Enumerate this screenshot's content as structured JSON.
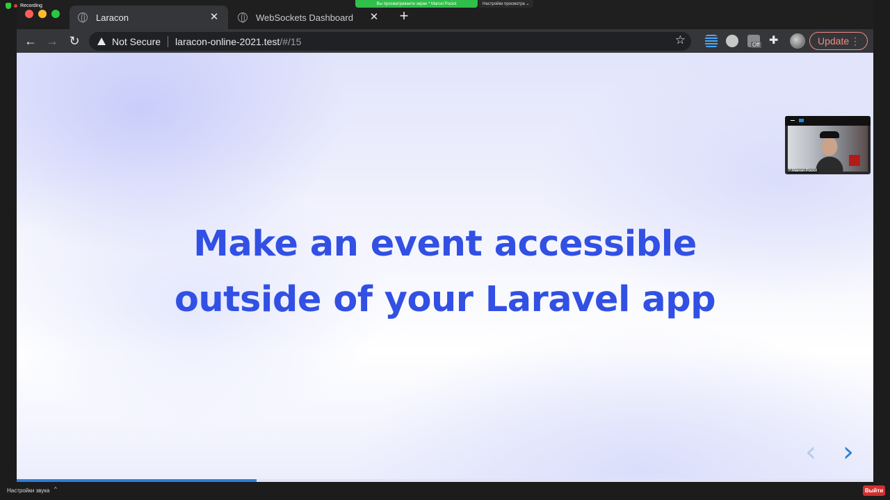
{
  "zoom": {
    "recording_label": "Recording",
    "share_banner": "Вы просматриваете экран * Marcel Pociot",
    "view_options": "Настройки просмотра ⌄",
    "sound_settings": "Настройки звука",
    "exit_label": "Выйти",
    "video_name": "* Marcel Pociot"
  },
  "browser": {
    "tabs": [
      {
        "title": "Laracon",
        "active": true
      },
      {
        "title": "WebSockets Dashboard",
        "active": false
      }
    ],
    "address": {
      "security_label": "Not Secure",
      "url_host": "laracon-online-2021.test",
      "url_rest": "/#/15"
    },
    "extension_badge": "Off",
    "update_label": "Update",
    "icons": {
      "back": "←",
      "forward": "→",
      "reload": "↻",
      "star": "☆",
      "puzzle": "✚",
      "close": "✕",
      "new_tab": "+",
      "kebab": "⋮"
    }
  },
  "slide": {
    "headline_line1": "Make an event accessible",
    "headline_line2": "outside of your Laravel app",
    "prev_arrow": "‹",
    "next_arrow": "›",
    "progress": 0.28,
    "text_color": "#3250e3",
    "accent_color": "#2d7fd8"
  }
}
